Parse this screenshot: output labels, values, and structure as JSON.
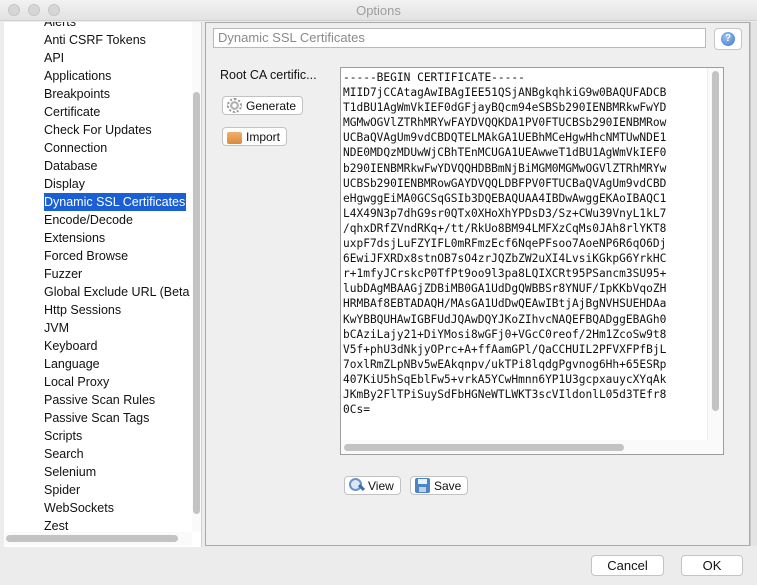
{
  "window": {
    "title": "Options"
  },
  "sidebar": {
    "items": [
      {
        "label": "Alerts",
        "selected": false
      },
      {
        "label": "Anti CSRF Tokens",
        "selected": false
      },
      {
        "label": "API",
        "selected": false
      },
      {
        "label": "Applications",
        "selected": false
      },
      {
        "label": "Breakpoints",
        "selected": false
      },
      {
        "label": "Certificate",
        "selected": false
      },
      {
        "label": "Check For Updates",
        "selected": false
      },
      {
        "label": "Connection",
        "selected": false
      },
      {
        "label": "Database",
        "selected": false
      },
      {
        "label": "Display",
        "selected": false
      },
      {
        "label": "Dynamic SSL Certificates",
        "selected": true
      },
      {
        "label": "Encode/Decode",
        "selected": false
      },
      {
        "label": "Extensions",
        "selected": false
      },
      {
        "label": "Forced Browse",
        "selected": false
      },
      {
        "label": "Fuzzer",
        "selected": false
      },
      {
        "label": "Global Exclude URL (Beta)",
        "selected": false
      },
      {
        "label": "Http Sessions",
        "selected": false
      },
      {
        "label": "JVM",
        "selected": false
      },
      {
        "label": "Keyboard",
        "selected": false
      },
      {
        "label": "Language",
        "selected": false
      },
      {
        "label": "Local Proxy",
        "selected": false
      },
      {
        "label": "Passive Scan Rules",
        "selected": false
      },
      {
        "label": "Passive Scan Tags",
        "selected": false
      },
      {
        "label": "Scripts",
        "selected": false
      },
      {
        "label": "Search",
        "selected": false
      },
      {
        "label": "Selenium",
        "selected": false
      },
      {
        "label": "Spider",
        "selected": false
      },
      {
        "label": "WebSockets",
        "selected": false
      },
      {
        "label": "Zest",
        "selected": false
      }
    ]
  },
  "panel": {
    "title": "Dynamic SSL Certificates",
    "help_icon": "help-icon",
    "root_ca_label": "Root CA certific...",
    "generate_label": "Generate",
    "import_label": "Import",
    "view_label": "View",
    "save_label": "Save",
    "certificate_lines": [
      "-----BEGIN CERTIFICATE-----",
      "MIID7jCCAtagAwIBAgIEE51QSjANBgkqhkiG9w0BAQUFADCB",
      "T1dBU1AgWmVkIEF0dGFjayBQcm94eSBSb290IENBMRkwFwYD",
      "MGMwOGVlZTRhMRYwFAYDVQQKDA1PV0FTUCBSb290IENBMRow",
      "UCBaQVAgUm9vdCBDQTELMAkGA1UEBhMCeHgwHhcNMTUwNDE1",
      "NDE0MDQzMDUwWjCBhTEnMCUGA1UEAwweT1dBU1AgWmVkIEF0",
      "b290IENBMRkwFwYDVQQHDBBmNjBiMGM0MGMwOGVlZTRhMRYw",
      "UCBSb290IENBMRowGAYDVQQLDBFPV0FTUCBaQVAgUm9vdCBD",
      "eHgwggEiMA0GCSqGSIb3DQEBAQUAA4IBDwAwggEKAoIBAQC1",
      "L4X49N3p7dhG9sr0QTx0XHoXhYPDsD3/Sz+CWu39VnyL1kL7",
      "/qhxDRfZVndRKq+/tt/RkUo8BM94LMFXzCqMs0JAh8rlYKT8",
      "uxpF7dsjLuFZYIFL0mRFmzEcf6NqePFsoo7AoeNP6R6qO6Dj",
      "6EwiJFXRDx8stnOB7sO4zrJQZbZW2uXI4LvsiKGkpG6YrkHC",
      "r+1mfyJCrskcP0TfPt9oo9l3pa8LQIXCRt95PSancm3SU95+",
      "lubDAgMBAAGjZDBiMB0GA1UdDgQWBBSr8YNUF/IpKKbVqoZH",
      "HRMBAf8EBTADAQH/MAsGA1UdDwQEAwIBtjAjBgNVHSUEHDAa",
      "KwYBBQUHAwIGBFUdJQAwDQYJKoZIhvcNAQEFBQADggEBAGh0",
      "bCAziLajy21+DiYMosi8wGFj0+VGcC0reof/2Hm1ZcoSw9t8",
      "V5f+phU3dNkjyOPrc+A+ffAamGPl/QaCCHUIL2PFVXFPfBjL",
      "7oxlRmZLpNBv5wEAkqnpv/ukTPi8lqdgPgvnog6Hh+65ESRp",
      "407KiU5hSqEblFw5+vrkA5YCwHmnn6YP1U3gcpxauycXYqAk",
      "JKmBy2FlTPiSuySdFbHGNeWTLWKT3scVIldonlL05d3TEfr8",
      "0Cs="
    ]
  },
  "footer": {
    "cancel_label": "Cancel",
    "ok_label": "OK"
  }
}
